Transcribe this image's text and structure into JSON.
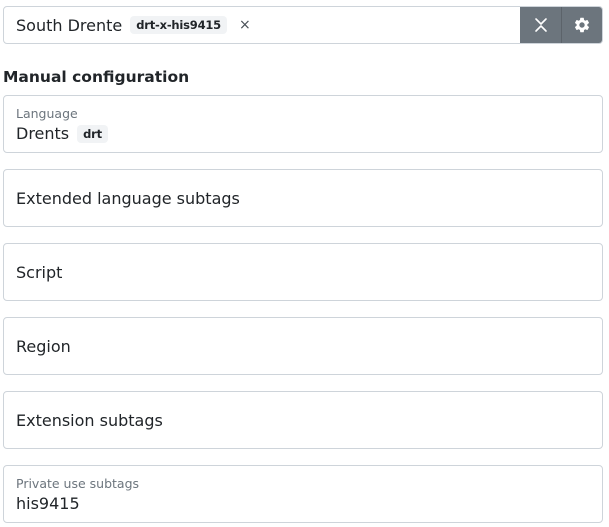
{
  "selector": {
    "language_name": "South Drente",
    "tag": "drt-x-his9415",
    "clear_symbol": "×",
    "collapse_icon": "collapse-chevrons-icon",
    "settings_icon": "gear-icon"
  },
  "section_heading": "Manual configuration",
  "fields": {
    "language": {
      "label": "Language",
      "value": "Drents",
      "code": "drt"
    },
    "extlang": {
      "label": "Extended language subtags"
    },
    "script": {
      "label": "Script"
    },
    "region": {
      "label": "Region"
    },
    "extension": {
      "label": "Extension subtags"
    },
    "private_use": {
      "label": "Private use subtags",
      "value": "his9415"
    }
  },
  "colors": {
    "border": "#ced4da",
    "button_bg": "#6c757d",
    "chip_bg": "#f1f3f5",
    "muted_text": "#6c757d"
  }
}
